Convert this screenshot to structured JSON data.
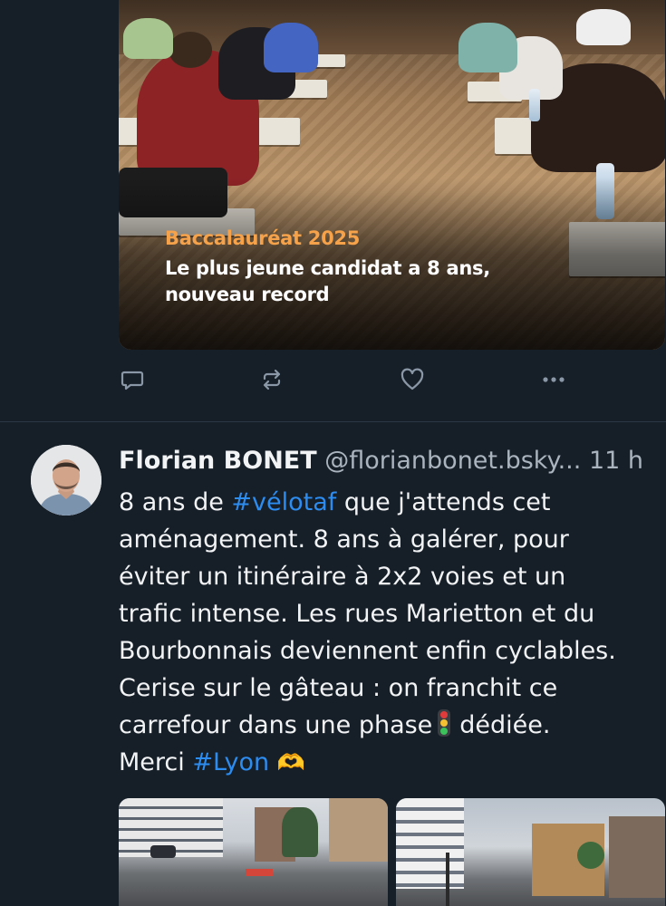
{
  "first_post": {
    "image_overlay": {
      "title": "Baccalauréat 2025",
      "subtitle_line1": "Le plus jeune candidat a 8 ans,",
      "subtitle_line2": "nouveau record"
    },
    "actions": {
      "reply_icon": "speech-bubble-icon",
      "repost_icon": "repost-arrows-icon",
      "like_icon": "heart-icon",
      "more_icon": "ellipsis-icon"
    }
  },
  "second_post": {
    "author": {
      "name": "Florian BONET",
      "handle": "@florianbonet.bsky...",
      "time": "11 h"
    },
    "text": {
      "l1_pre": "8 ans de ",
      "l1_tag": "#vélotaf",
      "l1_post": " que j'attends cet",
      "l2": "aménagement. 8 ans à galérer, pour",
      "l3": "éviter un itinéraire à 2x2 voies et un",
      "l4": "trafic intense. Les rues Marietton et du",
      "l5": "Bourbonnais deviennent enfin cyclables.",
      "l6": "Cerise sur le gâteau : on franchit ce",
      "l7_pre": "carrefour dans une phase",
      "l7_post": "dédiée.",
      "l8_pre": "Merci ",
      "l8_tag": "#Lyon",
      "l8_emoji": "🫶"
    }
  },
  "colors": {
    "background": "#161e27",
    "text": "#f1f3f5",
    "muted": "#aab4bf",
    "hashtag": "#2d8cf0",
    "overlay_title": "#f5a24b"
  }
}
